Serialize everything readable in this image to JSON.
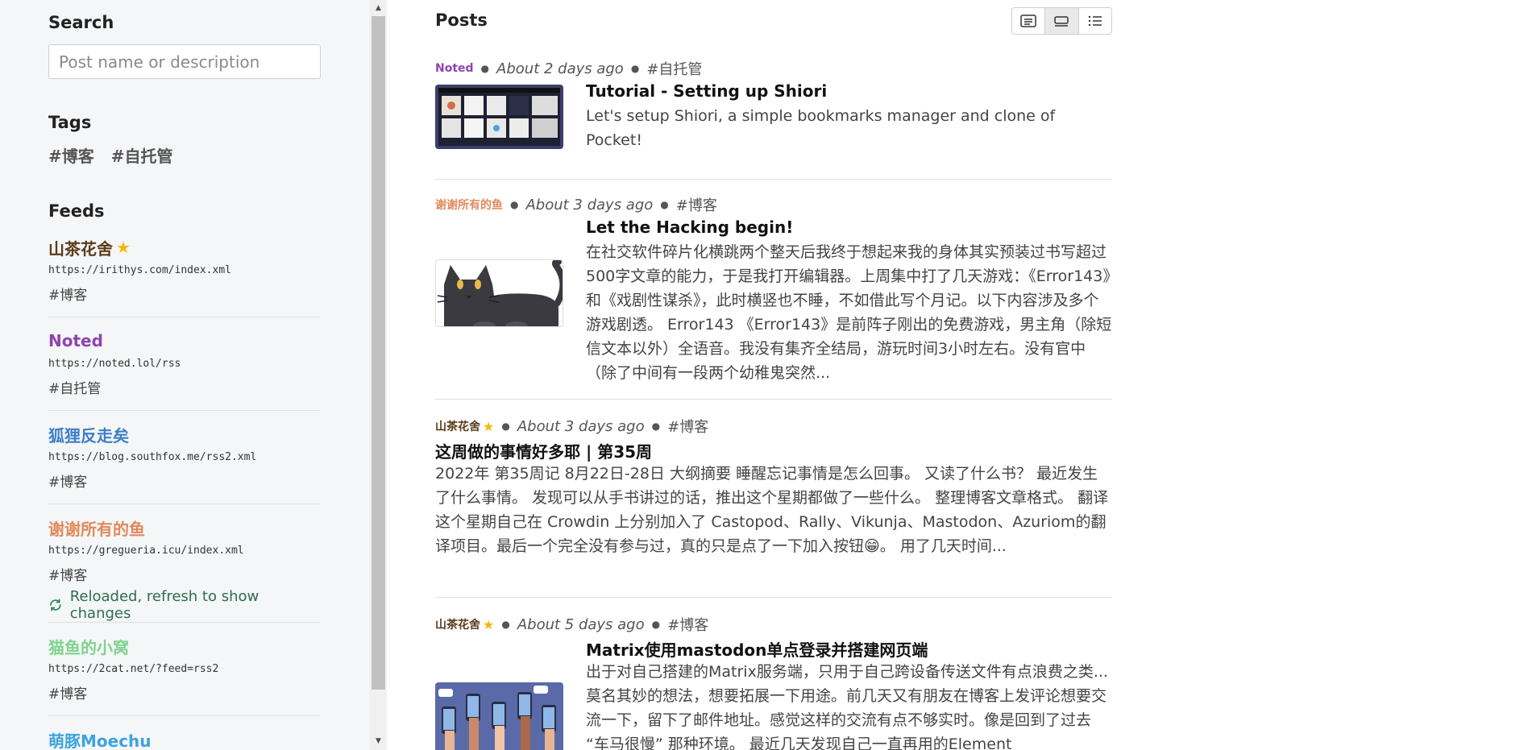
{
  "sidebar": {
    "search_heading": "Search",
    "search_placeholder": "Post name or description",
    "tags_heading": "Tags",
    "tags": [
      "#博客",
      "#自托管"
    ],
    "feeds_heading": "Feeds",
    "feeds": [
      {
        "name": "山茶花舍",
        "color": "#5a3b1a",
        "starred": true,
        "url": "https://irithys.com/index.xml",
        "tag": "#博客"
      },
      {
        "name": "Noted",
        "color": "#8e44ad",
        "starred": false,
        "url": "https://noted.lol/rss",
        "tag": "#自托管"
      },
      {
        "name": "狐狸反走矣",
        "color": "#3d7fc9",
        "starred": false,
        "url": "https://blog.southfox.me/rss2.xml",
        "tag": "#博客"
      },
      {
        "name": "谢谢所有的鱼",
        "color": "#e08a5c",
        "starred": false,
        "url": "https://gregueria.icu/index.xml",
        "tag": "#博客",
        "status": "Reloaded, refresh to show changes"
      },
      {
        "name": "猫鱼的小窝",
        "color": "#7fd38f",
        "starred": false,
        "url": "https://2cat.net/?feed=rss2",
        "tag": "#博客"
      },
      {
        "name": "萌豚Moechu",
        "color": "#3ba3e0",
        "starred": false
      }
    ]
  },
  "main": {
    "posts_heading": "Posts",
    "view_modes": [
      "card-view-icon",
      "compact-view-icon",
      "list-view-icon"
    ],
    "posts": [
      {
        "feed": "Noted",
        "feed_color": "#8e44ad",
        "starred": false,
        "time": "About 2 days ago",
        "tag": "#自托管",
        "title": "Tutorial - Setting up Shiori",
        "desc": "Let's setup Shiori, a simple bookmarks manager and clone of Pocket!"
      },
      {
        "feed": "谢谢所有的鱼",
        "feed_color": "#e08a5c",
        "starred": false,
        "time": "About 3 days ago",
        "tag": "#博客",
        "title": "Let the Hacking begin!",
        "desc": "在社交软件碎片化横跳两个整天后我终于想起来我的身体其实预装过书写超过500字文章的能力，于是我打开编辑器。上周集中打了几天游戏：《Error143》和《戏剧性谋杀》，此时横竖也不睡，不如借此写个月记。以下内容涉及多个游戏剧透。 Error143 《Error143》是前阵子刚出的免费游戏，男主角（除短信文本以外）全语音。我没有集齐全结局，游玩时间3小时左右。没有官中（除了中间有一段两个幼稚鬼突然..."
      },
      {
        "feed": "山茶花舍",
        "feed_color": "#5a3b1a",
        "starred": true,
        "time": "About 3 days ago",
        "tag": "#博客",
        "title": "这周做的事情好多耶 | 第35周",
        "desc": "2022年 第35周记 8月22日-28日 大纲摘要 睡醒忘记事情是怎么回事。 又读了什么书？ 最近发生了什么事情。 发现可以从手书讲过的话，推出这个星期都做了一些什么。 整理博客文章格式。 翻译 这个星期自己在 Crowdin 上分别加入了 Castopod、Rally、Vikunja、Mastodon、Azuriom的翻译项目。最后一个完全没有参与过，真的只是点了一下加入按钮😁。 用了几天时间..."
      },
      {
        "feed": "山茶花舍",
        "feed_color": "#5a3b1a",
        "starred": true,
        "time": "About 5 days ago",
        "tag": "#博客",
        "title": "Matrix使用mastodon单点登录并搭建网页端",
        "desc": "出于对自己搭建的Matrix服务端，只用于自己跨设备传送文件有点浪费之类...莫名其妙的想法，想要拓展一下用途。前几天又有朋友在博客上发评论想要交流一下，留下了邮件地址。感觉这样的交流有点不够实时。像是回到了过去 “车马很慢” 那种环境。 最近几天发现自己一直再用的Element"
      }
    ]
  }
}
